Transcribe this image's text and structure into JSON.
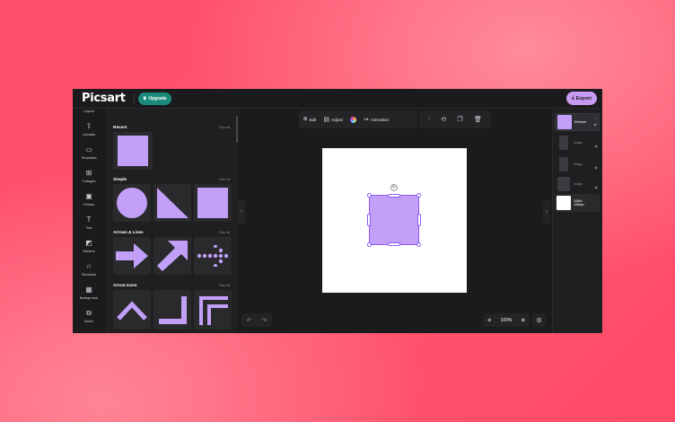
{
  "brand": {
    "logo": "Picsart",
    "upgrade_label": "Upgrade",
    "export_label": "Export"
  },
  "leftnav": [
    {
      "label": "Layout",
      "icon": "layout-icon"
    },
    {
      "label": "Uploads",
      "icon": "upload-icon"
    },
    {
      "label": "Templates",
      "icon": "book-icon"
    },
    {
      "label": "Collages",
      "icon": "grid-icon"
    },
    {
      "label": "Photos",
      "icon": "image-icon"
    },
    {
      "label": "Text",
      "icon": "text-icon"
    },
    {
      "label": "Stickers",
      "icon": "sticker-icon"
    },
    {
      "label": "Elements",
      "icon": "star-icon"
    },
    {
      "label": "Background",
      "icon": "background-icon"
    },
    {
      "label": "Batch",
      "icon": "batch-icon"
    }
  ],
  "panel": {
    "sections": [
      {
        "title": "Recent",
        "see_all": "See all"
      },
      {
        "title": "Simple",
        "see_all": "See all"
      },
      {
        "title": "Arrows & Lines",
        "see_all": "See all"
      },
      {
        "title": "Arrow Icons",
        "see_all": "See all"
      }
    ]
  },
  "toolbar": {
    "edit": "Edit",
    "adjust": "Adjust",
    "animation": "Animation"
  },
  "zoom": {
    "value": "100%"
  },
  "layers": [
    {
      "name": "Element",
      "active": true
    },
    {
      "name": "Image",
      "active": false
    },
    {
      "name": "Image",
      "active": false
    },
    {
      "name": "Image",
      "active": false
    },
    {
      "name": "1080x\n1080px",
      "line1": "1080x",
      "line2": "1080px",
      "active": false
    }
  ],
  "colors": {
    "accent": "#c2a0f8",
    "upgrade": "#1c8a7a",
    "export": "#c89bf2",
    "background": "#ff5670"
  }
}
